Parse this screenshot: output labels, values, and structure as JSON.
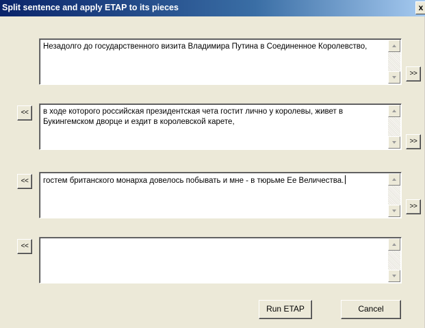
{
  "window": {
    "title": "Split sentence and apply ETAP to its pieces",
    "close_glyph": "x"
  },
  "pieces": [
    {
      "text": "Незадолго до государственного визита Владимира Путина в Соединенное Королевство,",
      "caret": false
    },
    {
      "text": "в ходе которого российская президентская чета гостит лично у королевы, живет в Букингемском дворце и ездит в королевской карете,",
      "caret": false
    },
    {
      "text": "гостем британского монарха довелось побывать и мне - в тюрьме Ее Величества.",
      "caret": true
    },
    {
      "text": "",
      "caret": false
    }
  ],
  "nav": {
    "merge_prev_label": "<<",
    "split_next_label": ">>"
  },
  "buttons": {
    "run_label": "Run ETAP",
    "cancel_label": "Cancel"
  },
  "icons": {
    "scroll_up": "scroll-up-arrow-icon",
    "scroll_down": "scroll-down-arrow-icon"
  }
}
